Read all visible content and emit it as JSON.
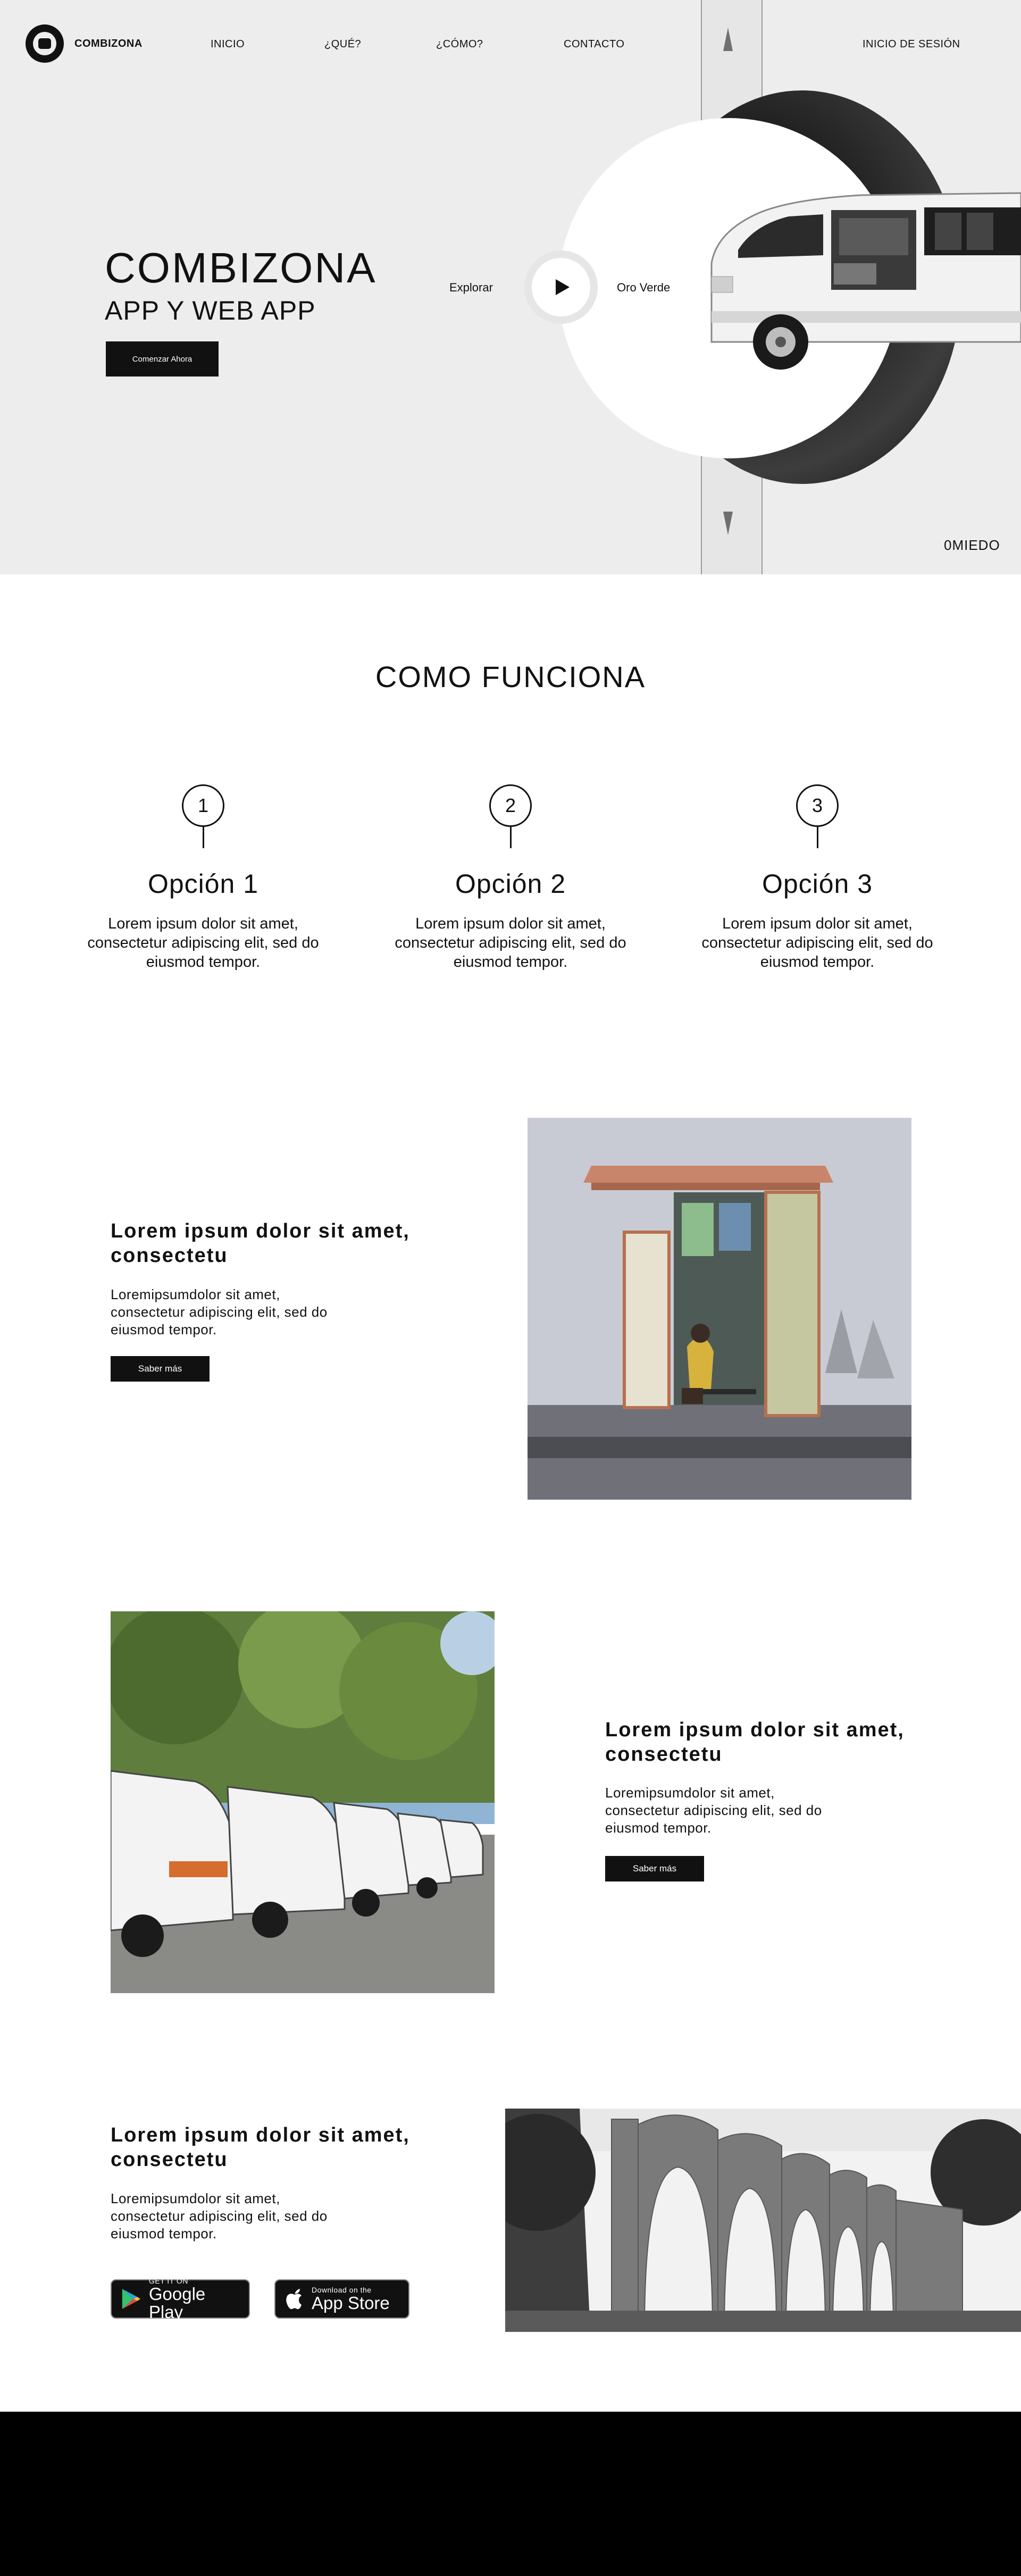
{
  "header": {
    "logo_text": "COMBIZONA",
    "nav": [
      "INICIO",
      "¿QUÉ?",
      "¿CÓMO?",
      "CONTACTO"
    ],
    "login": "INICIO DE SESIÓN"
  },
  "hero": {
    "title": "COMBIZONA",
    "subtitle": "APP Y WEB APP",
    "cta": "Comenzar Ahora",
    "explore": "Explorar",
    "location": "Oro Verde",
    "counter": "0MIEDO"
  },
  "how": {
    "title": "COMO FUNCIONA",
    "steps": [
      {
        "num": "1",
        "title": "Opción 1",
        "text": "Lorem ipsum dolor sit amet, consectetur adipiscing elit, sed do eiusmod tempor."
      },
      {
        "num": "2",
        "title": "Opción 2",
        "text": "Lorem ipsum dolor sit amet, consectetur adipiscing elit, sed do eiusmod tempor."
      },
      {
        "num": "3",
        "title": "Opción 3",
        "text": "Lorem ipsum dolor sit amet, consectetur adipiscing elit, sed do eiusmod tempor."
      }
    ]
  },
  "features": [
    {
      "title": "Lorem ipsum dolor sit amet, consectetu",
      "text": "Loremipsumdolor sit amet, consectetur adipiscing elit, sed do eiusmod tempor.",
      "button": "Saber más"
    },
    {
      "title": "Lorem ipsum dolor sit amet, consectetu",
      "text": "Loremipsumdolor sit amet, consectetur adipiscing elit, sed do eiusmod tempor.",
      "button": "Saber más"
    },
    {
      "title": "Lorem ipsum dolor sit amet, consectetu",
      "text": "Loremipsumdolor sit amet, consectetur adipiscing elit, sed do eiusmod tempor."
    }
  ],
  "stores": {
    "google_small": "GET IT ON",
    "google_big": "Google Play",
    "apple_small": "Download on the",
    "apple_big": "App Store"
  },
  "colors": {
    "primary": "#111111",
    "hero_bg": "#ededed",
    "footer": "#000000"
  }
}
